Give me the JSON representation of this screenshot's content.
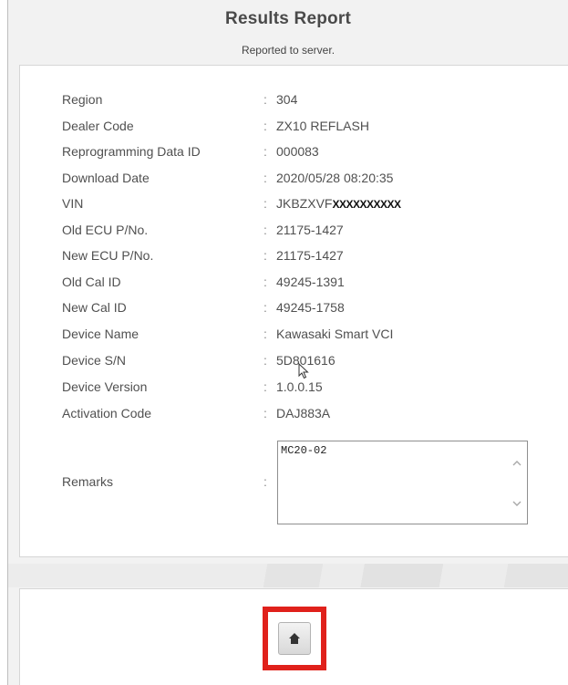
{
  "header": {
    "title": "Results Report",
    "status": "Reported to server."
  },
  "fields": [
    {
      "label": "Region",
      "value": "304"
    },
    {
      "label": "Dealer Code",
      "value": "ZX10 REFLASH"
    },
    {
      "label": "Reprogramming Data ID",
      "value": "000083"
    },
    {
      "label": "Download Date",
      "value": "2020/05/28 08:20:35"
    },
    {
      "label": "VIN",
      "value": "JKBZXVF",
      "redacted": "XXXXXXXXXX"
    },
    {
      "label": "Old ECU P/No.",
      "value": "21175-1427"
    },
    {
      "label": "New ECU P/No.",
      "value": "21175-1427"
    },
    {
      "label": "Old Cal ID",
      "value": "49245-1391"
    },
    {
      "label": "New Cal ID",
      "value": "49245-1758"
    },
    {
      "label": "Device Name",
      "value": "Kawasaki Smart VCI"
    },
    {
      "label": "Device S/N",
      "value": "5D801616"
    },
    {
      "label": "Device Version",
      "value": "1.0.0.15"
    },
    {
      "label": "Activation Code",
      "value": "DAJ883A"
    }
  ],
  "remarks": {
    "label": "Remarks",
    "value": "MC20-02"
  },
  "colon": ":",
  "icons": {
    "home": "home-icon",
    "scroll_up": "chevron-up-icon",
    "scroll_down": "chevron-down-icon"
  },
  "colors": {
    "highlight": "#e0211b",
    "panel": "#ffffff",
    "background": "#f2f2f2"
  }
}
